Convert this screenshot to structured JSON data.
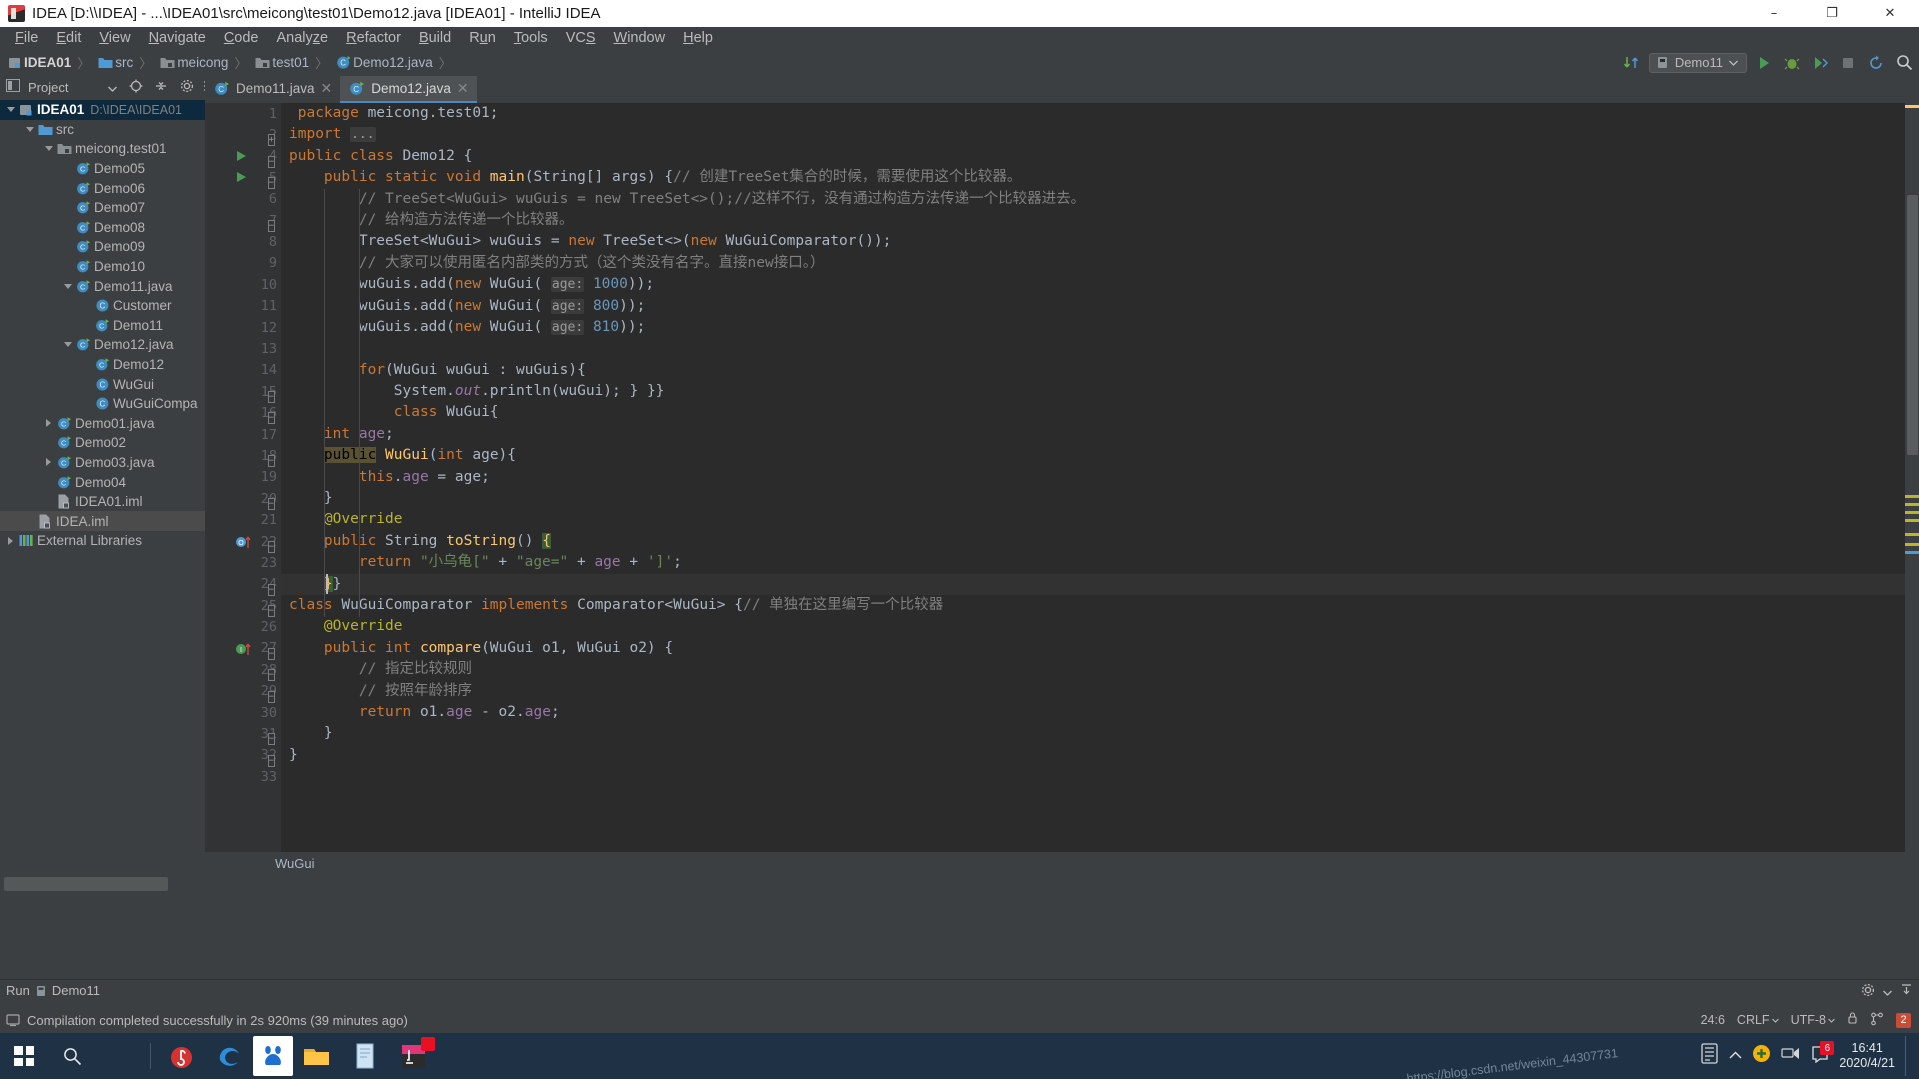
{
  "window": {
    "title": "IDEA [D:\\\\IDEA] - ...\\IDEA01\\src\\meicong\\test01\\Demo12.java [IDEA01] - IntelliJ IDEA",
    "minimize": "–",
    "maximize": "❐",
    "close": "✕"
  },
  "menu": {
    "items": [
      "File",
      "Edit",
      "View",
      "Navigate",
      "Code",
      "Analyze",
      "Refactor",
      "Build",
      "Run",
      "Tools",
      "VCS",
      "Window",
      "Help"
    ]
  },
  "breadcrumb": {
    "items": [
      {
        "label": "IDEA01",
        "icon": "module-icon"
      },
      {
        "label": "src",
        "icon": "source-folder-icon"
      },
      {
        "label": "meicong",
        "icon": "package-icon"
      },
      {
        "label": "test01",
        "icon": "package-icon"
      },
      {
        "label": "Demo12.java",
        "icon": "java-class-icon"
      }
    ],
    "separator": "〉"
  },
  "toolbar": {
    "run_config": "Demo11",
    "run_button": "run-icon",
    "debug_button": "debug-icon",
    "coverage_button": "coverage-icon",
    "stop_button": "stop-icon",
    "update_button": "update-icon",
    "search_button": "search-icon",
    "vcs_updown": "vcs-icon"
  },
  "project_panel": {
    "title": "Project",
    "tree": [
      {
        "depth": 0,
        "arrow": "down",
        "icon": "module-icon",
        "label": "IDEA01",
        "sub": "D:\\IDEA\\IDEA01",
        "selected": true
      },
      {
        "depth": 1,
        "arrow": "down",
        "icon": "source-folder-icon",
        "label": "src",
        "sub": ""
      },
      {
        "depth": 2,
        "arrow": "down",
        "icon": "package-icon",
        "label": "meicong.test01",
        "sub": ""
      },
      {
        "depth": 3,
        "arrow": "none",
        "icon": "java-class-run-icon",
        "label": "Demo05",
        "sub": ""
      },
      {
        "depth": 3,
        "arrow": "none",
        "icon": "java-class-run-icon",
        "label": "Demo06",
        "sub": ""
      },
      {
        "depth": 3,
        "arrow": "none",
        "icon": "java-class-run-icon",
        "label": "Demo07",
        "sub": ""
      },
      {
        "depth": 3,
        "arrow": "none",
        "icon": "java-class-run-icon",
        "label": "Demo08",
        "sub": ""
      },
      {
        "depth": 3,
        "arrow": "none",
        "icon": "java-class-run-icon",
        "label": "Demo09",
        "sub": ""
      },
      {
        "depth": 3,
        "arrow": "none",
        "icon": "java-class-run-icon",
        "label": "Demo10",
        "sub": ""
      },
      {
        "depth": 3,
        "arrow": "down",
        "icon": "java-class-run-icon",
        "label": "Demo11.java",
        "sub": ""
      },
      {
        "depth": 4,
        "arrow": "none",
        "icon": "java-class-icon",
        "label": "Customer",
        "sub": ""
      },
      {
        "depth": 4,
        "arrow": "none",
        "icon": "java-class-run-icon",
        "label": "Demo11",
        "sub": ""
      },
      {
        "depth": 3,
        "arrow": "down",
        "icon": "java-class-run-icon",
        "label": "Demo12.java",
        "sub": ""
      },
      {
        "depth": 4,
        "arrow": "none",
        "icon": "java-class-run-icon",
        "label": "Demo12",
        "sub": ""
      },
      {
        "depth": 4,
        "arrow": "none",
        "icon": "java-class-icon",
        "label": "WuGui",
        "sub": ""
      },
      {
        "depth": 4,
        "arrow": "none",
        "icon": "java-class-icon",
        "label": "WuGuiCompa",
        "sub": ""
      },
      {
        "depth": 2,
        "arrow": "right",
        "icon": "java-class-run-icon",
        "label": "Demo01.java",
        "sub": ""
      },
      {
        "depth": 2,
        "arrow": "none",
        "icon": "java-class-run-icon",
        "label": "Demo02",
        "sub": ""
      },
      {
        "depth": 2,
        "arrow": "right",
        "icon": "java-class-run-icon",
        "label": "Demo03.java",
        "sub": ""
      },
      {
        "depth": 2,
        "arrow": "none",
        "icon": "java-class-run-icon",
        "label": "Demo04",
        "sub": ""
      },
      {
        "depth": 2,
        "arrow": "none",
        "icon": "iml-file-icon",
        "label": "IDEA01.iml",
        "sub": ""
      },
      {
        "depth": 1,
        "arrow": "none",
        "icon": "iml-file-icon",
        "label": "IDEA.iml",
        "sub": "",
        "selected2": true
      },
      {
        "depth": 0,
        "arrow": "right",
        "icon": "external-libraries-icon",
        "label": "External Libraries",
        "sub": ""
      }
    ]
  },
  "editor": {
    "tabs": [
      {
        "label": "Demo11.java",
        "active": false,
        "close": "✕"
      },
      {
        "label": "Demo12.java",
        "active": true,
        "close": "✕"
      }
    ],
    "breadcrumb_bottom": "WuGui",
    "lines": [
      {
        "n": "1",
        "fold": "",
        "run": false,
        "tokens": [
          {
            "t": " ",
            "c": "txt"
          },
          {
            "t": "package",
            "c": "kw"
          },
          {
            "t": " meicong.test01;",
            "c": "txt"
          }
        ]
      },
      {
        "n": "2",
        "fold": "plus",
        "run": false,
        "tokens": [
          {
            "t": "import ",
            "c": "kw"
          },
          {
            "t": "...",
            "c": "hint"
          }
        ]
      },
      {
        "n": "4",
        "fold": "top",
        "run": true,
        "tokens": [
          {
            "t": "public class ",
            "c": "kw"
          },
          {
            "t": "Demo12 {",
            "c": "txt"
          }
        ]
      },
      {
        "n": "5",
        "fold": "minus",
        "run": true,
        "tokens": [
          {
            "t": "    ",
            "c": "txt"
          },
          {
            "t": "public static void ",
            "c": "kw"
          },
          {
            "t": "main",
            "c": "fn"
          },
          {
            "t": "(String[] args) {",
            "c": "txt"
          },
          {
            "t": "// 创建TreeSet集合的时候，需要使用这个比较器。",
            "c": "cmt"
          }
        ]
      },
      {
        "n": "6",
        "fold": "",
        "run": false,
        "tokens": [
          {
            "t": "        // TreeSet<WuGui> wuGuis = new TreeSet<>();//这样不行，没有通过构造方法传递一个比较器进去。",
            "c": "cmt"
          }
        ]
      },
      {
        "n": "7",
        "fold": "top2",
        "run": false,
        "tokens": [
          {
            "t": "        // 给构造方法传递一个比较器。",
            "c": "cmt"
          }
        ]
      },
      {
        "n": "8",
        "fold": "",
        "run": false,
        "tokens": [
          {
            "t": "        TreeSet<WuGui> wuGuis = ",
            "c": "txt"
          },
          {
            "t": "new ",
            "c": "kw"
          },
          {
            "t": "TreeSet<>(",
            "c": "txt"
          },
          {
            "t": "new ",
            "c": "kw"
          },
          {
            "t": "WuGuiComparator());",
            "c": "txt"
          }
        ]
      },
      {
        "n": "9",
        "fold": "",
        "run": false,
        "tokens": [
          {
            "t": "        // 大家可以使用匿名内部类的方式（这个类没有名字。直接new接口。）",
            "c": "cmt"
          }
        ]
      },
      {
        "n": "10",
        "fold": "",
        "run": false,
        "tokens": [
          {
            "t": "        wuGuis.add(",
            "c": "txt"
          },
          {
            "t": "new ",
            "c": "kw"
          },
          {
            "t": "WuGui( ",
            "c": "txt"
          },
          {
            "t": "age:",
            "c": "hint"
          },
          {
            "t": " ",
            "c": "txt"
          },
          {
            "t": "1000",
            "c": "num"
          },
          {
            "t": "));",
            "c": "txt"
          }
        ]
      },
      {
        "n": "11",
        "fold": "",
        "run": false,
        "tokens": [
          {
            "t": "        wuGuis.add(",
            "c": "txt"
          },
          {
            "t": "new ",
            "c": "kw"
          },
          {
            "t": "WuGui( ",
            "c": "txt"
          },
          {
            "t": "age:",
            "c": "hint"
          },
          {
            "t": " ",
            "c": "txt"
          },
          {
            "t": "800",
            "c": "num"
          },
          {
            "t": "));",
            "c": "txt"
          }
        ]
      },
      {
        "n": "12",
        "fold": "",
        "run": false,
        "tokens": [
          {
            "t": "        wuGuis.add(",
            "c": "txt"
          },
          {
            "t": "new ",
            "c": "kw"
          },
          {
            "t": "WuGui( ",
            "c": "txt"
          },
          {
            "t": "age:",
            "c": "hint"
          },
          {
            "t": " ",
            "c": "txt"
          },
          {
            "t": "810",
            "c": "num"
          },
          {
            "t": "));",
            "c": "txt"
          }
        ]
      },
      {
        "n": "13",
        "fold": "",
        "run": false,
        "tokens": [
          {
            "t": "",
            "c": "txt"
          }
        ]
      },
      {
        "n": "14",
        "fold": "",
        "run": false,
        "tokens": [
          {
            "t": "        ",
            "c": "txt"
          },
          {
            "t": "for",
            "c": "kw"
          },
          {
            "t": "(WuGui wuGui : wuGuis){",
            "c": "txt"
          }
        ]
      },
      {
        "n": "15",
        "fold": "top3",
        "run": false,
        "tokens": [
          {
            "t": "            System.",
            "c": "txt"
          },
          {
            "t": "out",
            "c": "stf"
          },
          {
            "t": ".println(wuGui); } }}",
            "c": "txt"
          }
        ]
      },
      {
        "n": "16",
        "fold": "minus2",
        "run": false,
        "tokens": [
          {
            "t": "            ",
            "c": "txt"
          },
          {
            "t": "class ",
            "c": "kw"
          },
          {
            "t": "WuGui{",
            "c": "txt"
          }
        ]
      },
      {
        "n": "17",
        "fold": "",
        "run": false,
        "tokens": [
          {
            "t": "    ",
            "c": "txt"
          },
          {
            "t": "int ",
            "c": "kw"
          },
          {
            "t": "age",
            "c": "fld"
          },
          {
            "t": ";",
            "c": "txt"
          }
        ]
      },
      {
        "n": "18",
        "fold": "minus3",
        "run": false,
        "tokens": [
          {
            "t": "    ",
            "c": "txt"
          },
          {
            "t": "public",
            "c": "selw"
          },
          {
            "t": " ",
            "c": "txt"
          },
          {
            "t": "WuGui",
            "c": "fn"
          },
          {
            "t": "(",
            "c": "txt"
          },
          {
            "t": "int ",
            "c": "kw"
          },
          {
            "t": "age){",
            "c": "txt"
          }
        ]
      },
      {
        "n": "19",
        "fold": "",
        "run": false,
        "tokens": [
          {
            "t": "        ",
            "c": "txt"
          },
          {
            "t": "this",
            "c": "kw"
          },
          {
            "t": ".",
            "c": "txt"
          },
          {
            "t": "age",
            "c": "fld"
          },
          {
            "t": " = age;",
            "c": "txt"
          }
        ]
      },
      {
        "n": "20",
        "fold": "end",
        "run": false,
        "tokens": [
          {
            "t": "    }",
            "c": "txt"
          }
        ]
      },
      {
        "n": "21",
        "fold": "",
        "run": false,
        "tokens": [
          {
            "t": "    ",
            "c": "txt"
          },
          {
            "t": "@Override",
            "c": "anno"
          }
        ]
      },
      {
        "n": "22",
        "fold": "minus4",
        "run": false,
        "marker": "override-up",
        "tokens": [
          {
            "t": "    ",
            "c": "txt"
          },
          {
            "t": "public ",
            "c": "kw"
          },
          {
            "t": "String ",
            "c": "txt"
          },
          {
            "t": "toString",
            "c": "fn"
          },
          {
            "t": "() ",
            "c": "txt"
          },
          {
            "t": "{",
            "c": "brhl"
          }
        ]
      },
      {
        "n": "23",
        "fold": "",
        "run": false,
        "tokens": [
          {
            "t": "        ",
            "c": "txt"
          },
          {
            "t": "return ",
            "c": "kw"
          },
          {
            "t": "\"小乌龟[\"",
            "c": "str"
          },
          {
            "t": " + ",
            "c": "txt"
          },
          {
            "t": "\"age=\"",
            "c": "str"
          },
          {
            "t": " + ",
            "c": "txt"
          },
          {
            "t": "age",
            "c": "fld"
          },
          {
            "t": " + ",
            "c": "txt"
          },
          {
            "t": "']'",
            "c": "str"
          },
          {
            "t": ";",
            "c": "txt"
          }
        ]
      },
      {
        "n": "24",
        "fold": "end2",
        "run": false,
        "hl": true,
        "tokens": [
          {
            "t": "    ",
            "c": "txt"
          },
          {
            "t": "}",
            "c": "brhl"
          },
          {
            "t": "}",
            "c": "txt"
          }
        ]
      },
      {
        "n": "25",
        "fold": "top4",
        "run": false,
        "tokens": [
          {
            "t": "class ",
            "c": "kw"
          },
          {
            "t": "WuGuiComparator ",
            "c": "txt"
          },
          {
            "t": "implements ",
            "c": "kw"
          },
          {
            "t": "Comparator<WuGui> {",
            "c": "txt"
          },
          {
            "t": "// 单独在这里编写一个比较器",
            "c": "cmt"
          }
        ]
      },
      {
        "n": "26",
        "fold": "",
        "run": false,
        "tokens": [
          {
            "t": "    ",
            "c": "txt"
          },
          {
            "t": "@Override",
            "c": "anno"
          }
        ]
      },
      {
        "n": "27",
        "fold": "minus5",
        "run": false,
        "marker": "impl-up",
        "tokens": [
          {
            "t": "    ",
            "c": "txt"
          },
          {
            "t": "public ",
            "c": "kw"
          },
          {
            "t": "int ",
            "c": "kw"
          },
          {
            "t": "compare",
            "c": "fn"
          },
          {
            "t": "(WuGui o1, WuGui o2) {",
            "c": "txt"
          }
        ]
      },
      {
        "n": "28",
        "fold": "minus6",
        "run": false,
        "tokens": [
          {
            "t": "        // 指定比较规则",
            "c": "cmt"
          }
        ]
      },
      {
        "n": "29",
        "fold": "minus7",
        "run": false,
        "tokens": [
          {
            "t": "        // 按照年龄排序",
            "c": "cmt"
          }
        ]
      },
      {
        "n": "30",
        "fold": "",
        "run": false,
        "tokens": [
          {
            "t": "        ",
            "c": "txt"
          },
          {
            "t": "return ",
            "c": "kw"
          },
          {
            "t": "o1.",
            "c": "txt"
          },
          {
            "t": "age",
            "c": "fld"
          },
          {
            "t": " - o2.",
            "c": "txt"
          },
          {
            "t": "age",
            "c": "fld"
          },
          {
            "t": ";",
            "c": "txt"
          }
        ]
      },
      {
        "n": "31",
        "fold": "end3",
        "run": false,
        "tokens": [
          {
            "t": "    }",
            "c": "txt"
          }
        ]
      },
      {
        "n": "32",
        "fold": "end4",
        "run": false,
        "tokens": [
          {
            "t": "}",
            "c": "txt"
          }
        ]
      },
      {
        "n": "33",
        "fold": "",
        "run": false,
        "tokens": [
          {
            "t": "",
            "c": "txt"
          }
        ]
      }
    ]
  },
  "run_window": {
    "label": "Run",
    "config": "Demo11",
    "gear_icon": "settings-icon",
    "hide_icon": "hide-icon"
  },
  "status_bar": {
    "message": "Compilation completed successfully in 2s 920ms (39 minutes ago)",
    "caret": "24:6",
    "line_separator": "CRLF",
    "encoding": "UTF-8",
    "lock_icon": "lock-icon",
    "branch_icon": "branch-icon",
    "notification_count": "2"
  },
  "taskbar": {
    "items": [
      {
        "name": "start-button",
        "glyph": "win"
      },
      {
        "name": "search-button",
        "glyph": "search"
      },
      {
        "name": "cortana-button",
        "glyph": "cortana"
      },
      {
        "name": "divider",
        "glyph": "div"
      },
      {
        "name": "app-netease",
        "glyph": "netease"
      },
      {
        "name": "app-edge",
        "glyph": "edge"
      },
      {
        "name": "app-baidu-netdisk",
        "glyph": "baidu"
      },
      {
        "name": "app-file-explorer",
        "glyph": "folder"
      },
      {
        "name": "app-notepad",
        "glyph": "note"
      },
      {
        "name": "app-intellij-idea",
        "glyph": "idea"
      }
    ],
    "tray": {
      "keyboard_icon": "keyboard-icon",
      "chevron_icon": "chevron-up-icon",
      "shield_icon": "security-icon",
      "network_icon": "network-icon",
      "notification_badge": "6",
      "time": "16:41",
      "date": "2020/4/21",
      "watermark": "https://blog.csdn.net/weixin_44307731"
    }
  }
}
